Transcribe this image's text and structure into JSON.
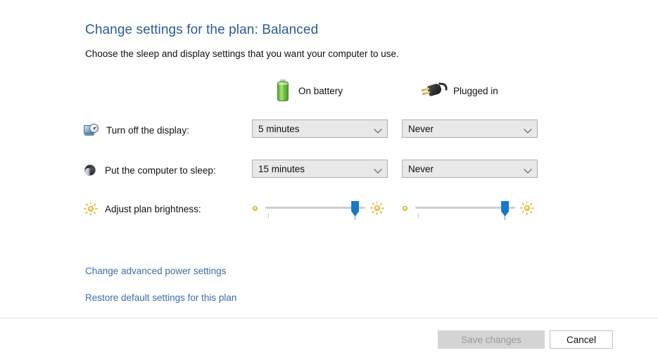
{
  "header": {
    "title": "Change settings for the plan: Balanced",
    "subtitle": "Choose the sleep and display settings that you want your computer to use."
  },
  "columns": [
    {
      "key": "battery",
      "label": "On battery",
      "icon": "battery-icon"
    },
    {
      "key": "plugged",
      "label": "Plugged in",
      "icon": "power-plug-icon"
    }
  ],
  "rows": [
    {
      "key": "turn_off_display",
      "label": "Turn off the display:",
      "icon": "display-clock-icon",
      "type": "dropdown",
      "battery_value": "5 minutes",
      "plugged_value": "Never"
    },
    {
      "key": "sleep",
      "label": "Put the computer to sleep:",
      "icon": "sleep-icon",
      "type": "dropdown",
      "battery_value": "15 minutes",
      "plugged_value": "Never"
    },
    {
      "key": "brightness",
      "label": "Adjust plan brightness:",
      "icon": "brightness-sun-icon",
      "type": "slider",
      "battery_value": "86",
      "plugged_value": "86"
    }
  ],
  "links": [
    {
      "key": "advanced",
      "label": "Change advanced power settings"
    },
    {
      "key": "restore",
      "label": "Restore default settings for this plan"
    }
  ],
  "footer": {
    "save_label": "Save changes",
    "cancel_label": "Cancel",
    "save_enabled": false
  },
  "colors": {
    "title_blue": "#2b5b94",
    "link_blue": "#3b6ea5",
    "slider_thumb": "#1878c8",
    "battery_green": "#5aa832",
    "dropdown_bg": "#e8e8e8",
    "save_disabled_bg": "#d4d4d4"
  }
}
